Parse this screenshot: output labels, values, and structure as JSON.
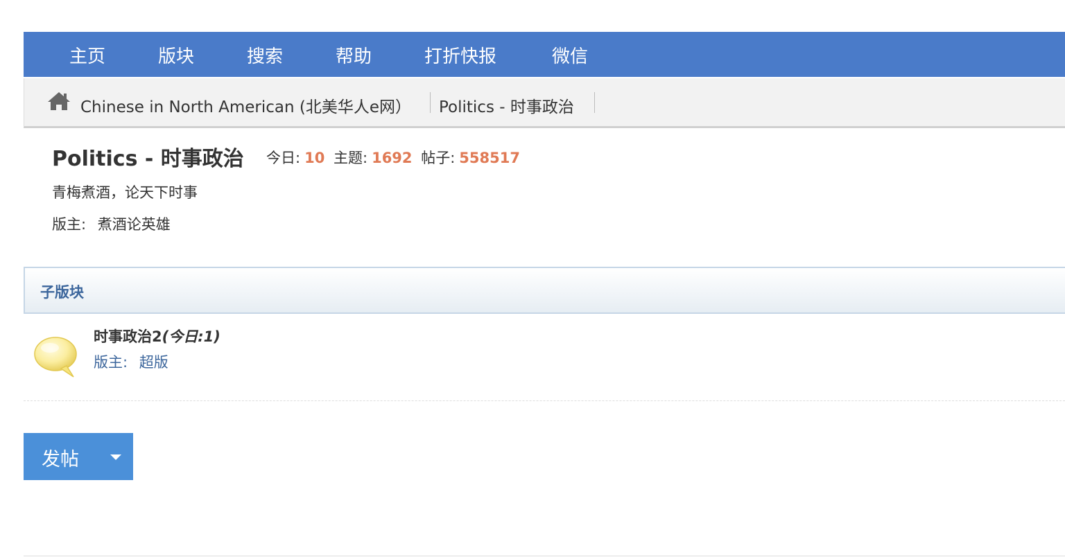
{
  "nav": {
    "items": [
      {
        "label": "主页"
      },
      {
        "label": "版块"
      },
      {
        "label": "搜索"
      },
      {
        "label": "帮助"
      },
      {
        "label": "打折快报"
      },
      {
        "label": "微信"
      }
    ]
  },
  "breadcrumb": {
    "home_icon": "home-icon",
    "site": "Chinese in North American (北美华人e网）",
    "forum": "Politics - 时事政治"
  },
  "forum": {
    "title": "Politics - 时事政治",
    "stats": {
      "today_label": "今日:",
      "today_value": "10",
      "topics_label": "主题:",
      "topics_value": "1692",
      "posts_label": "帖子:",
      "posts_value": "558517"
    },
    "description": "青梅煮酒，论天下时事",
    "moderator_label": "版主:",
    "moderator_name": "煮酒论英雄"
  },
  "subforums": {
    "header": "子版块",
    "items": [
      {
        "icon": "speech-bubble-icon",
        "name": "时事政治2",
        "today": "(今日:1)",
        "moderator_label": "版主:",
        "moderator_name": "超版"
      }
    ]
  },
  "actions": {
    "post_label": "发帖",
    "dropdown_icon": "caret-down-icon"
  },
  "colors": {
    "nav_bg": "#4a7bc9",
    "stat_number": "#e07a55",
    "link_blue": "#3c669c",
    "button_bg": "#4b90d9"
  }
}
